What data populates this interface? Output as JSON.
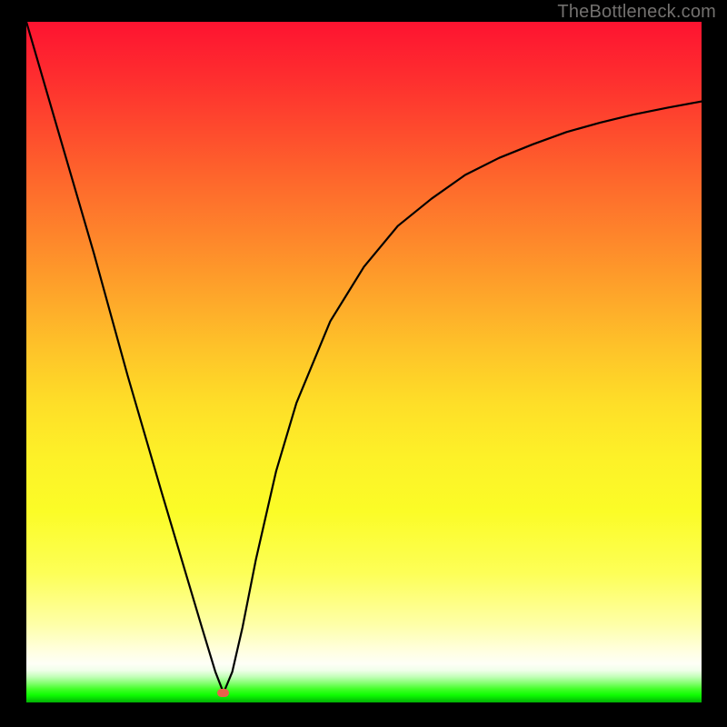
{
  "watermark": "TheBottleneck.com",
  "colors": {
    "background": "#000000",
    "marker": "#eb614c",
    "curve": "#000000",
    "gradient_top": "#fe1330",
    "gradient_bottom_green": "#03af05"
  },
  "marker_position": {
    "x_frac": 0.292,
    "y_frac": 0.986
  },
  "chart_data": {
    "type": "line",
    "title": "",
    "xlabel": "",
    "ylabel": "",
    "xlim": [
      0,
      1
    ],
    "ylim": [
      0,
      1
    ],
    "annotations": [
      "TheBottleneck.com"
    ],
    "marker": {
      "x": 0.292,
      "y": 0.014
    },
    "series": [
      {
        "name": "bottleneck-curve",
        "x": [
          0.0,
          0.05,
          0.1,
          0.15,
          0.2,
          0.23,
          0.26,
          0.28,
          0.292,
          0.305,
          0.32,
          0.34,
          0.37,
          0.4,
          0.45,
          0.5,
          0.55,
          0.6,
          0.65,
          0.7,
          0.75,
          0.8,
          0.85,
          0.9,
          0.95,
          1.0
        ],
        "y": [
          1.0,
          0.83,
          0.66,
          0.48,
          0.31,
          0.21,
          0.11,
          0.045,
          0.014,
          0.045,
          0.11,
          0.21,
          0.34,
          0.44,
          0.56,
          0.64,
          0.7,
          0.74,
          0.775,
          0.8,
          0.82,
          0.838,
          0.852,
          0.864,
          0.874,
          0.883
        ]
      }
    ]
  }
}
